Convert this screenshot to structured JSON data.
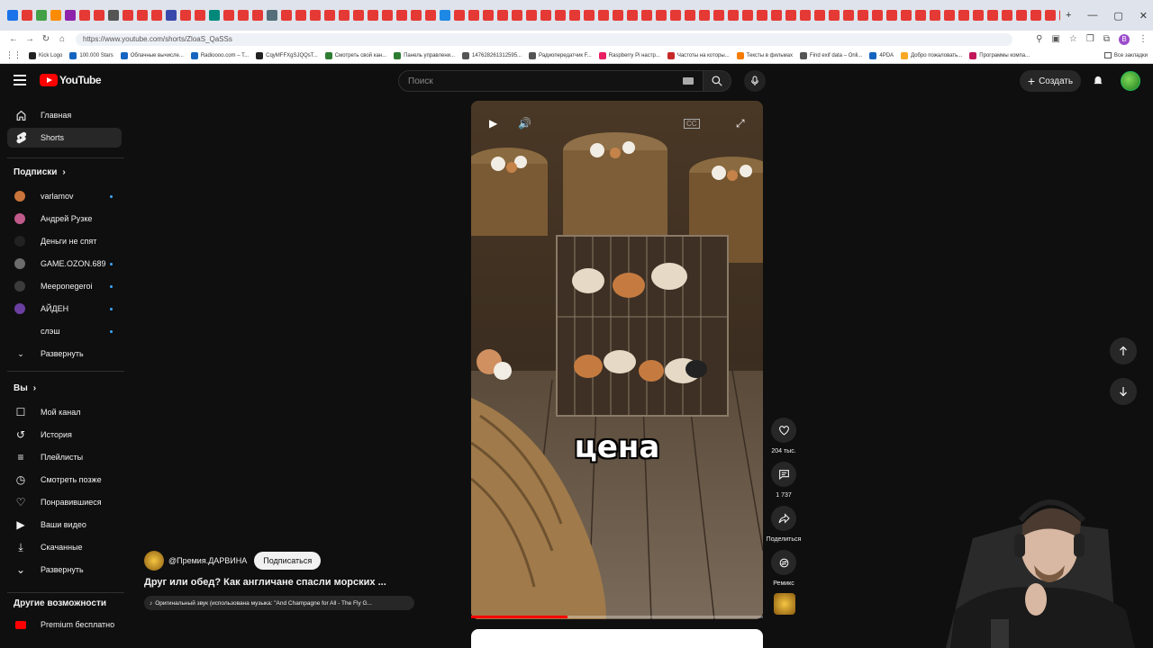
{
  "browser": {
    "url": "https://www.youtube.com/shorts/ZloaS_QaSSs",
    "bookmarks": [
      "Kick Logo",
      "100.000 Stars",
      "Облачные вычисле...",
      "Radioooo.com – T...",
      "CqyMFFXgSJQQsT...",
      "Смотреть свой кан...",
      "Панель управлени...",
      "147628261312595...",
      "Радиопередатчик F...",
      "Raspberry Pi настр...",
      "Частоты на которы...",
      "Тексты в фильмах",
      "Find exif data – Onli...",
      "4PDA",
      "Добро пожаловать...",
      "Программы компа..."
    ],
    "all_bookmarks": "Все закладки",
    "profile_initial": "B",
    "accent": "#9c4dcc"
  },
  "header": {
    "logo_text": "YouTube",
    "search_placeholder": "Поиск",
    "create_label": "Создать"
  },
  "sidebar": {
    "home": "Главная",
    "shorts": "Shorts",
    "subs_title": "Подписки",
    "channels": [
      {
        "name": "varlamov",
        "color": "#c9743b",
        "live": true
      },
      {
        "name": "Андрей Рузке",
        "color": "#c05a8a",
        "live": false
      },
      {
        "name": "Деньги не спят",
        "color": "#222222",
        "live": false
      },
      {
        "name": "GAME.OZON.689",
        "color": "#6c6c6c",
        "live": true
      },
      {
        "name": "Meeponegeroi",
        "color": "#3b3b3b",
        "live": true
      },
      {
        "name": "АЙДЕН",
        "color": "#6a3fa0",
        "live": true
      },
      {
        "name": "слэш",
        "color": "#0f0f0f",
        "live": true
      }
    ],
    "expand": "Развернуть",
    "you_title": "Вы",
    "you_items": [
      "Мой канал",
      "История",
      "Плейлисты",
      "Смотреть позже",
      "Понравившиеся",
      "Ваши видео",
      "Скачанные",
      "Развернуть"
    ],
    "more_title": "Другие возможности",
    "premium": "Premium бесплатно"
  },
  "short": {
    "caption": "цена",
    "progress_fraction": 0.33,
    "channel": "@Премия.ДАРВИНА",
    "subscribe": "Подписаться",
    "title": "Друг или обед? Как англичане спасли морских ...",
    "sound": "Оригинальный звук (использована музыка: \"And Champagne for All - The Fly G..."
  },
  "actions": {
    "likes": "204 тыс.",
    "comments": "1 737",
    "share": "Поделиться",
    "remix": "Ремикс"
  }
}
